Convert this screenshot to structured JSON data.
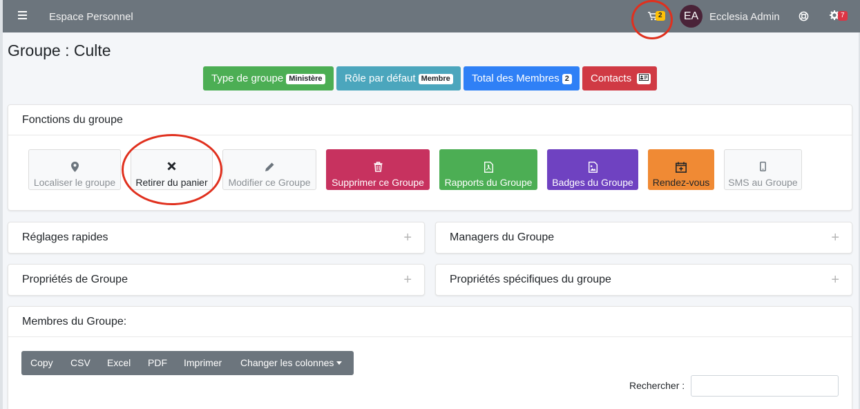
{
  "navbar": {
    "brand": "Espace Personnel",
    "cart_count": "2",
    "avatar_initials": "EA",
    "user_name": "Ecclesia Admin",
    "settings_count": "7",
    "icons": [
      "menu-icon",
      "cart-icon",
      "help-icon",
      "gear-icon"
    ]
  },
  "page": {
    "title": "Groupe : Culte"
  },
  "info_buttons": [
    {
      "label": "Type de groupe",
      "badge": "Ministère",
      "color": "#4cae54"
    },
    {
      "label": "Rôle par défaut",
      "badge": "Membre",
      "color": "#4ba6bd"
    },
    {
      "label": "Total des Membres",
      "badge": "2",
      "color": "#2f80f6"
    },
    {
      "label": "Contacts",
      "badge_icon": "contact-card-icon",
      "color": "#d03a44"
    }
  ],
  "functions_card": {
    "title": "Fonctions du groupe",
    "buttons": [
      {
        "label": "Localiser le groupe",
        "icon": "map-marker-icon"
      },
      {
        "label": "Retirer du panier",
        "icon": "remove-x-icon"
      },
      {
        "label": "Modifier ce Groupe",
        "icon": "pencil-icon"
      },
      {
        "label": "Supprimer ce Groupe",
        "icon": "trash-icon",
        "color": "#c7325f"
      },
      {
        "label": "Rapports du Groupe",
        "icon": "pdf-file-icon",
        "color": "#4cae54"
      },
      {
        "label": "Badges du Groupe",
        "icon": "image-file-icon",
        "color": "#6f42c1"
      },
      {
        "label": "Rendez-vous",
        "icon": "calendar-plus-icon",
        "color": "#f08a34"
      },
      {
        "label": "SMS au Groupe",
        "icon": "mobile-icon"
      }
    ]
  },
  "panels": {
    "quick_settings": "Réglages rapides",
    "managers": "Managers du Groupe",
    "group_properties": "Propriétés de Groupe",
    "specific_properties": "Propriétés spécifiques du groupe"
  },
  "members_card": {
    "title": "Membres du Groupe:",
    "toolbar": [
      "Copy",
      "CSV",
      "Excel",
      "PDF",
      "Imprimer",
      "Changer les colonnes"
    ],
    "search_label": "Rechercher :",
    "search_value": ""
  },
  "annotation_color": "#e0301e"
}
